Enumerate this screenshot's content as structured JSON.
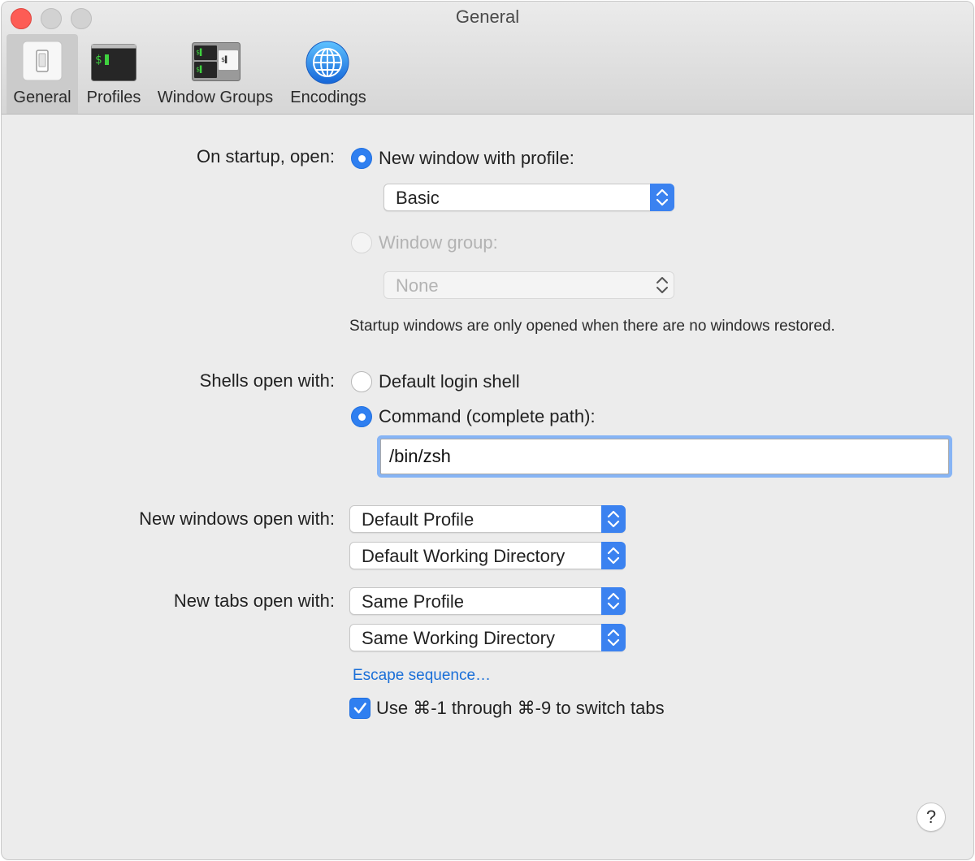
{
  "window": {
    "title": "General"
  },
  "toolbar": {
    "tabs": [
      {
        "label": "General",
        "icon": "light-switch-icon",
        "selected": true
      },
      {
        "label": "Profiles",
        "icon": "terminal-icon",
        "selected": false
      },
      {
        "label": "Window Groups",
        "icon": "window-groups-icon",
        "selected": false
      },
      {
        "label": "Encodings",
        "icon": "globe-icon",
        "selected": false
      }
    ]
  },
  "startup": {
    "label": "On startup, open:",
    "new_window_option": "New window with profile:",
    "new_window_selected": true,
    "profile_value": "Basic",
    "window_group_option": "Window group:",
    "window_group_enabled": false,
    "window_group_value": "None",
    "hint": "Startup windows are only opened when there are no windows restored."
  },
  "shells": {
    "label": "Shells open with:",
    "default_login_option": "Default login shell",
    "default_login_selected": false,
    "command_option": "Command (complete path):",
    "command_selected": true,
    "command_value": "/bin/zsh"
  },
  "new_windows": {
    "label": "New windows open with:",
    "profile_value": "Default Profile",
    "directory_value": "Default Working Directory"
  },
  "new_tabs": {
    "label": "New tabs open with:",
    "profile_value": "Same Profile",
    "directory_value": "Same Working Directory"
  },
  "escape_link": "Escape sequence…",
  "switch_tabs": {
    "label": "Use ⌘-1 through ⌘-9 to switch tabs",
    "checked": true
  },
  "help_label": "?",
  "colors": {
    "accent": "#2f7ff0",
    "link": "#1a6fd8",
    "close": "#fd5c55"
  }
}
